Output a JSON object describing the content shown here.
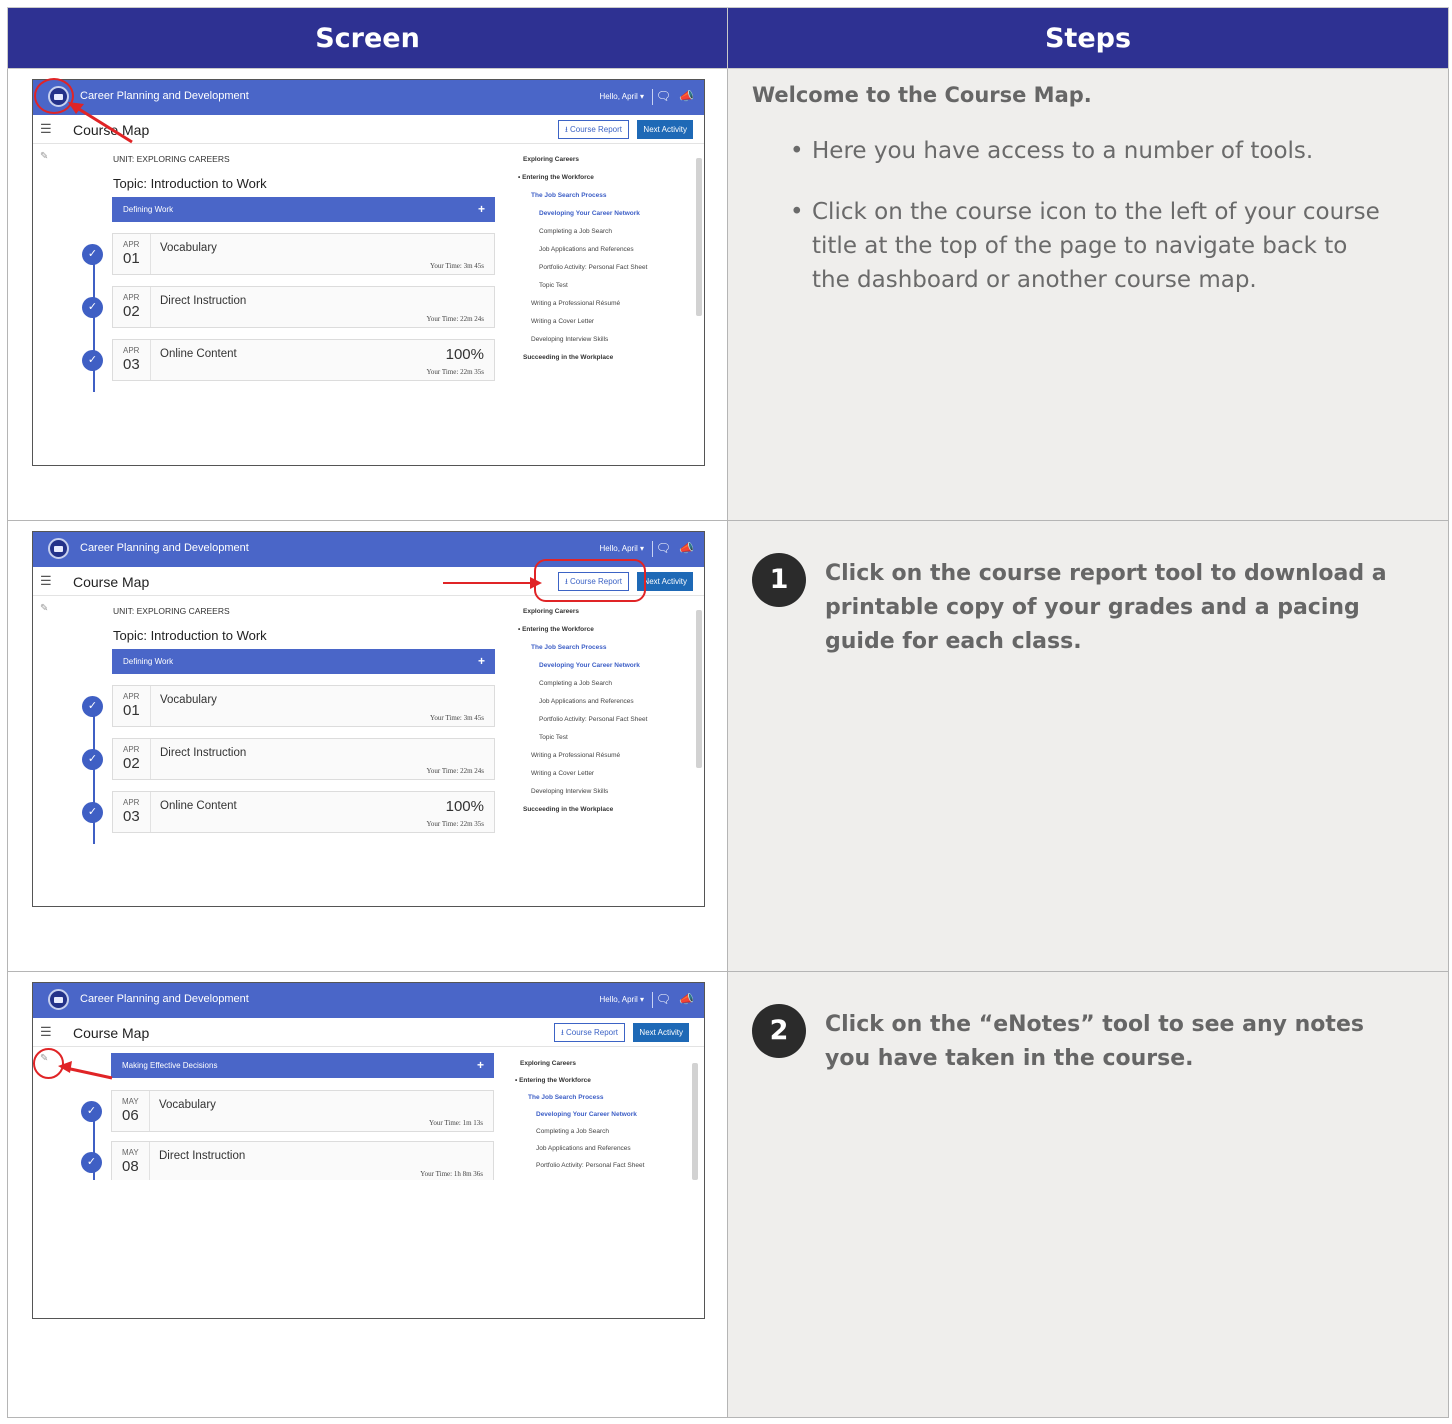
{
  "headers": {
    "screen": "Screen",
    "steps": "Steps"
  },
  "app": {
    "course_title": "Career Planning and Development",
    "hello": "Hello, April ▾",
    "page_title": "Course Map",
    "course_report": "⭳ Course Report",
    "next_activity": "Next Activity",
    "unit": "UNIT: EXPLORING CAREERS",
    "topic": "Topic: Introduction to Work",
    "lesson1": "Defining Work",
    "lesson3": "Making Effective Decisions",
    "activities": [
      {
        "month": "APR",
        "day": "01",
        "name": "Vocabulary",
        "time": "Your Time: 3m 45s",
        "pct": ""
      },
      {
        "month": "APR",
        "day": "02",
        "name": "Direct Instruction",
        "time": "Your Time: 22m 24s",
        "pct": ""
      },
      {
        "month": "APR",
        "day": "03",
        "name": "Online Content",
        "time": "Your Time: 22m 35s",
        "pct": "100%"
      }
    ],
    "activities3": [
      {
        "month": "MAY",
        "day": "06",
        "name": "Vocabulary",
        "time": "Your Time: 1m 13s"
      },
      {
        "month": "MAY",
        "day": "08",
        "name": "Direct Instruction",
        "time": "Your Time: 1h 8m 36s"
      }
    ],
    "outline": [
      "Exploring Careers",
      "• Entering the Workforce",
      "The Job Search Process",
      "Developing Your Career Network",
      "Completing a Job Search",
      "Job Applications and References",
      "Portfolio Activity: Personal Fact Sheet",
      "Topic Test",
      "Writing a Professional Résumé",
      "Writing a Cover Letter",
      "Developing Interview Skills",
      "Succeeding in the Workplace"
    ]
  },
  "steps": {
    "welcome": "Welcome to the Course Map.",
    "bullets": [
      "Here you have access to a number of tools.",
      "Click on the course icon to the left of your course title at the top of the page to navigate back to the dashboard or another course map."
    ],
    "step1_num": "1",
    "step1_text": "Click on the course report tool to download a printable copy of your grades and a pacing guide for each class.",
    "step2_num": "2",
    "step2_text": "Click on the “eNotes” tool to see any notes you have taken in the course."
  },
  "colors": {
    "header": "#2e3192",
    "app_blue": "#4a66c8",
    "annotation_red": "#e02426",
    "steps_bg": "#efeeec"
  },
  "icons": [
    "course-logo-icon",
    "chat-icon",
    "megaphone-icon",
    "list-menu-icon",
    "download-icon",
    "edit-icon",
    "checkmark-icon",
    "plus-icon"
  ]
}
